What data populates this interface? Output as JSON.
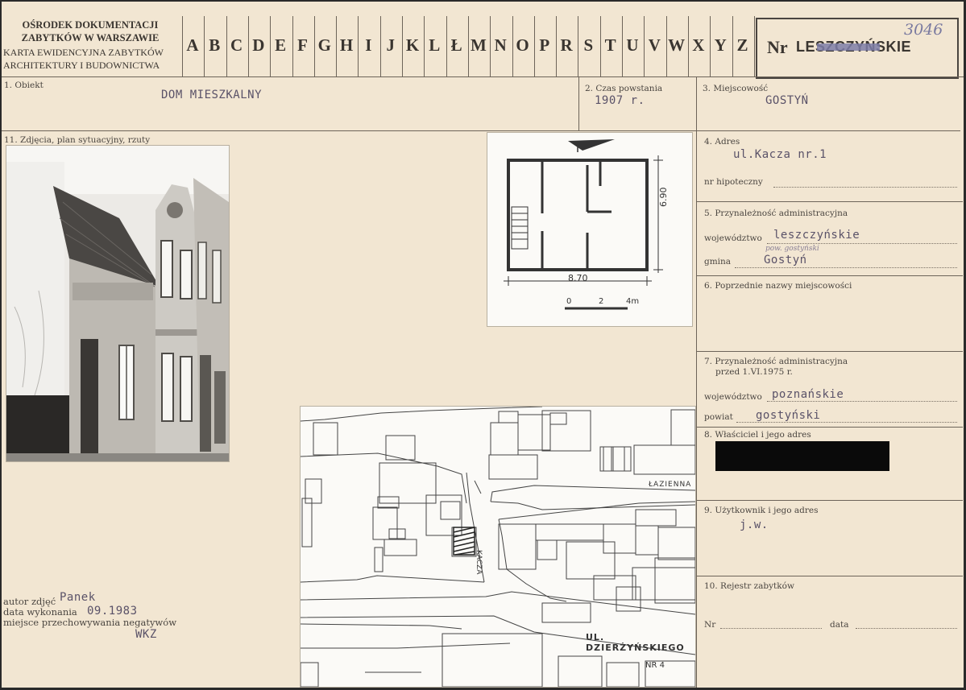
{
  "header": {
    "org_line1": "OŚRODEK DOKUMENTACJI",
    "org_line2": "ZABYTKÓW W WARSZAWIE",
    "card_line1": "KARTA EWIDENCYJNA ZABYTKÓW",
    "card_line2": "ARCHITEKTURY I BUDOWNICTWA",
    "letters": [
      "A",
      "B",
      "C",
      "D",
      "E",
      "F",
      "G",
      "H",
      "I",
      "J",
      "K",
      "L",
      "Ł",
      "M",
      "N",
      "O",
      "P",
      "R",
      "S",
      "T",
      "U",
      "V",
      "W",
      "X",
      "Y",
      "Z"
    ],
    "nr_label": "Nr",
    "nr_value": "LESZCZYŃSKIE",
    "nr_handwritten": "3046"
  },
  "fields": {
    "obiekt_label": "1. Obiekt",
    "obiekt_value": "DOM MIESZKALNY",
    "czas_label": "2. Czas powstania",
    "czas_value": "1907 r.",
    "miejscowosc_label": "3. Miejscowość",
    "miejscowosc_value": "GOSTYŃ",
    "zdjecia_label": "11. Zdjęcia, plan sytuacyjny, rzuty",
    "adres_label": "4. Adres",
    "adres_value": "ul.Kacza nr.1",
    "hipoteczny_label": "nr hipoteczny",
    "przynaleznosc_label": "5. Przynależność administracyjna",
    "wojewodztwo_label": "województwo",
    "wojewodztwo_value": "leszczyńskie",
    "pow_note": "pow. gostyński",
    "gmina_label": "gmina",
    "gmina_value": "Gostyń",
    "poprzednie_label": "6. Poprzednie nazwy miejscowości",
    "przynaleznosc_old_label1": "7. Przynależność administracyjna",
    "przynaleznosc_old_label2": "przed 1.VI.1975 r.",
    "wojewodztwo_old_label": "województwo",
    "wojewodztwo_old_value": "poznańskie",
    "powiat_label": "powiat",
    "powiat_value": "gostyński",
    "wlasciciel_label": "8. Właściciel i jego adres",
    "uzytkownik_label": "9. Użytkownik i jego adres",
    "uzytkownik_value": "j.w.",
    "rejestr_label": "10. Rejestr zabytków",
    "rejestr_nr_label": "Nr",
    "rejestr_data_label": "data",
    "autor_label": "autor zdjęć",
    "autor_value": "Panek",
    "data_label": "data wykonania",
    "data_value": "09.1983",
    "miejsce_label": "miejsce przechowywania negatywów",
    "miejsce_value": "WKZ"
  },
  "plan": {
    "width_label": "8.70",
    "depth_label": "6.90",
    "scale_ticks": [
      "0",
      "2",
      "4m"
    ]
  },
  "map": {
    "street_lazienna": "ŁAZIENNA",
    "street_kacza": "KACZA",
    "street_dzierzynskiego": "UL. DZIERŻYŃSKIEGO",
    "nr_label": "NR 4"
  }
}
